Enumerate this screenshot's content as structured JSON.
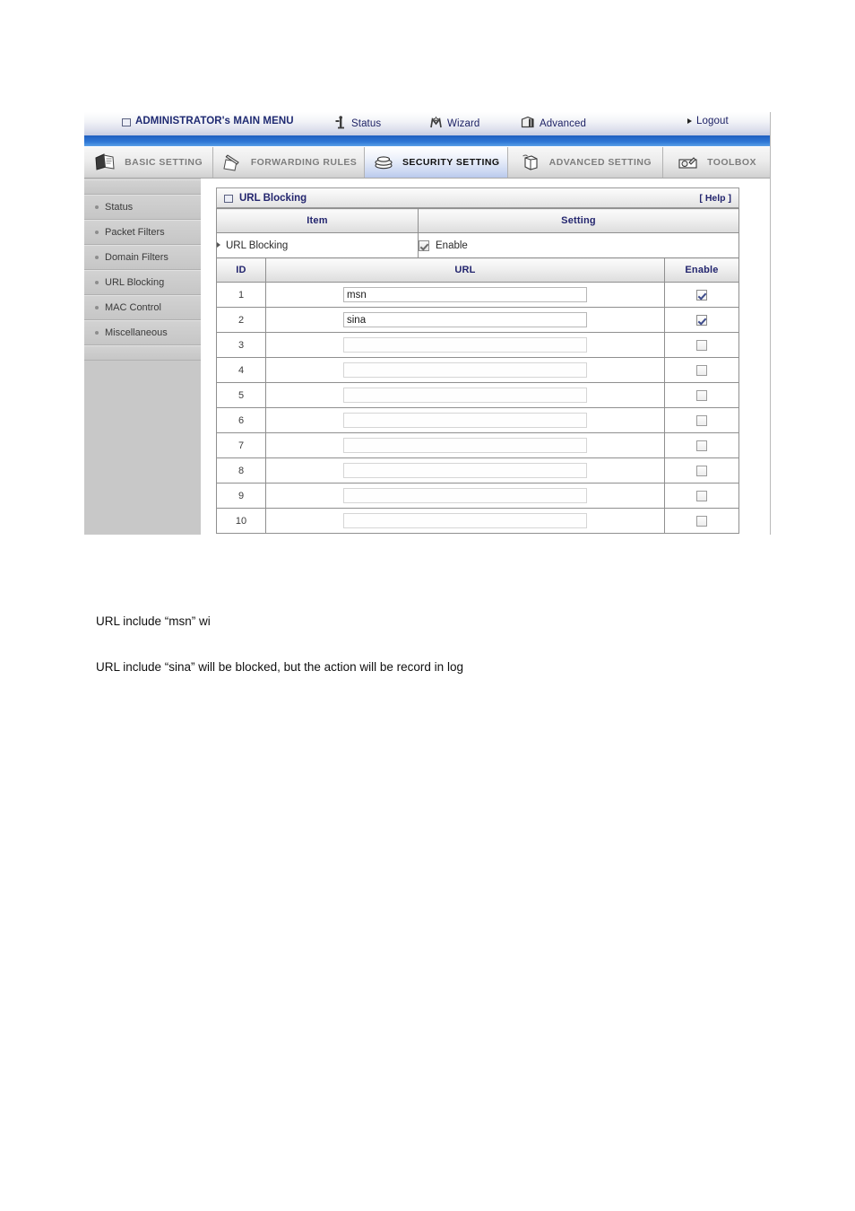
{
  "admin_bar": {
    "main_menu_label": "ADMINISTRATOR's MAIN MENU",
    "status_label": "Status",
    "wizard_label": "Wizard",
    "advanced_label": "Advanced",
    "logout_label": "Logout"
  },
  "tabs": [
    {
      "label": "BASIC SETTING",
      "icon": "books-icon",
      "active": false
    },
    {
      "label": "FORWARDING RULES",
      "icon": "pencil-paper-icon",
      "active": false
    },
    {
      "label": "SECURITY SETTING",
      "icon": "shield-stack-icon",
      "active": true
    },
    {
      "label": "ADVANCED SETTING",
      "icon": "open-box-icon",
      "active": false
    },
    {
      "label": "TOOLBOX",
      "icon": "toolbox-gear-icon",
      "active": false
    }
  ],
  "sidebar": {
    "items": [
      {
        "label": "Status"
      },
      {
        "label": "Packet Filters"
      },
      {
        "label": "Domain Filters"
      },
      {
        "label": "URL Blocking"
      },
      {
        "label": "MAC Control"
      },
      {
        "label": "Miscellaneous"
      }
    ]
  },
  "panel": {
    "title": "URL Blocking",
    "help_label": "[ Help ]",
    "header_item": "Item",
    "header_setting": "Setting",
    "url_blocking_row": {
      "item_label": "URL Blocking",
      "enable_label": "Enable",
      "enabled": true
    },
    "table_headers": {
      "id": "ID",
      "url": "URL",
      "enable": "Enable"
    },
    "rows": [
      {
        "id": "1",
        "url": "msn",
        "enabled": true
      },
      {
        "id": "2",
        "url": "sina",
        "enabled": true
      },
      {
        "id": "3",
        "url": "",
        "enabled": false
      },
      {
        "id": "4",
        "url": "",
        "enabled": false
      },
      {
        "id": "5",
        "url": "",
        "enabled": false
      },
      {
        "id": "6",
        "url": "",
        "enabled": false
      },
      {
        "id": "7",
        "url": "",
        "enabled": false
      },
      {
        "id": "8",
        "url": "",
        "enabled": false
      },
      {
        "id": "9",
        "url": "",
        "enabled": false
      },
      {
        "id": "10",
        "url": "",
        "enabled": false
      }
    ]
  },
  "captions": {
    "line1": "URL include “msn” wi",
    "line2": "URL include “sina” will be blocked, but the action will be record in log"
  },
  "colors": {
    "accent_blue": "#23256e",
    "strip_blue": "#2f78d6",
    "sidebar_gray": "#c8c8c8",
    "active_tab": "#ccd8f2"
  }
}
